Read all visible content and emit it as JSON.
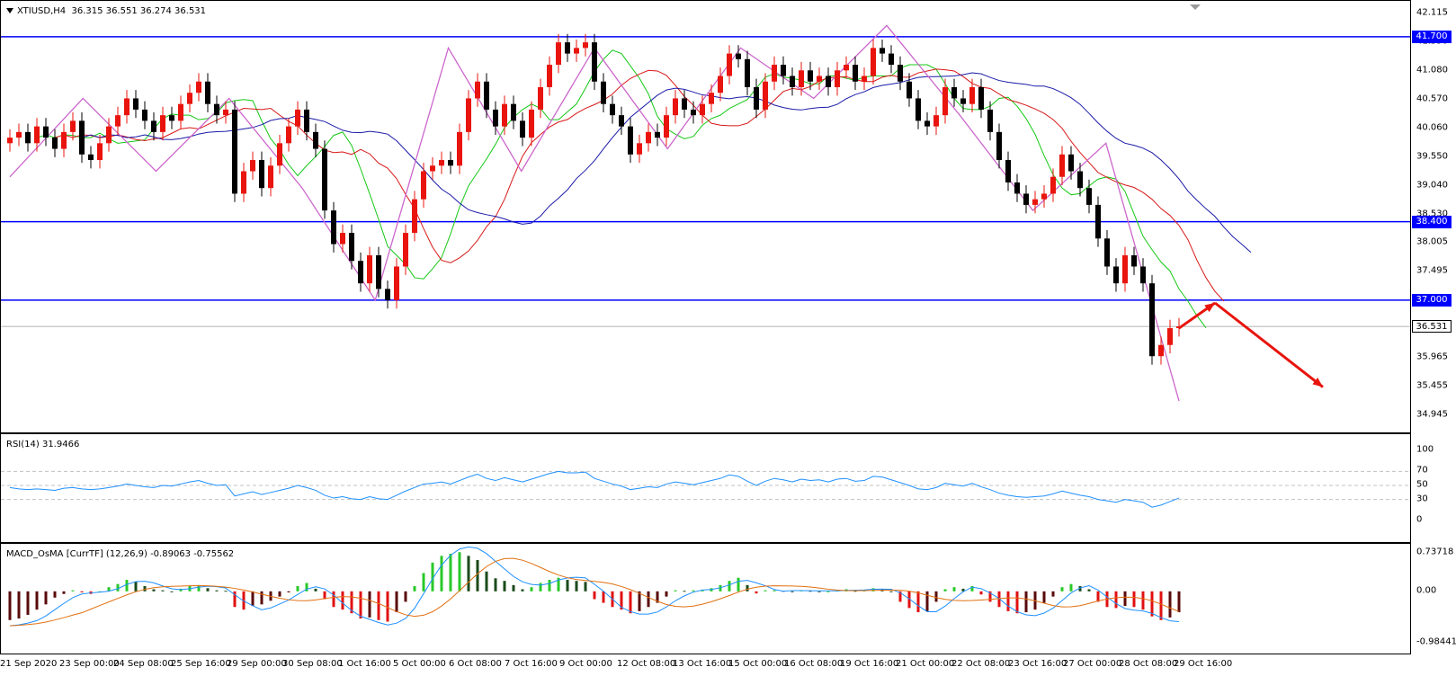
{
  "chart_header": {
    "symbol_timeframe": "XTIUSD,H4",
    "ohlc": "36.315 36.551 36.274 36.531"
  },
  "price_axis": [
    "42.115",
    "41.590",
    "41.080",
    "40.570",
    "40.060",
    "39.550",
    "39.040",
    "38.530",
    "38.005",
    "37.495",
    "36.985",
    "36.475",
    "35.965",
    "35.455",
    "34.945"
  ],
  "levels": [
    {
      "name": "resistance-41700",
      "label": "41.700",
      "value": 41.7,
      "color": "#0000ff"
    },
    {
      "name": "support-38400",
      "label": "38.400",
      "value": 38.4,
      "color": "#0000ff"
    },
    {
      "name": "support-37000",
      "label": "37.000",
      "value": 37.0,
      "color": "#0000ff"
    }
  ],
  "current_price": {
    "label": "36.531",
    "value": 36.531
  },
  "rsi": {
    "title": "RSI(14) 31.9466",
    "axis": [
      "100",
      "70",
      "50",
      "30",
      "0"
    ]
  },
  "macd": {
    "title": "MACD_OsMA [CurrTF] (12,26,9) -0.89063 -0.75562",
    "axis": [
      "0.73718",
      "0.00",
      "-0.98441"
    ]
  },
  "time_axis": [
    "21 Sep 2020",
    "23 Sep 00:00",
    "24 Sep 08:00",
    "25 Sep 16:00",
    "29 Sep 00:00",
    "30 Sep 08:00",
    "1 Oct 16:00",
    "5 Oct 00:00",
    "6 Oct 08:00",
    "7 Oct 16:00",
    "9 Oct 00:00",
    "12 Oct 08:00",
    "13 Oct 16:00",
    "15 Oct 00:00",
    "16 Oct 08:00",
    "19 Oct 16:00",
    "21 Oct 00:00",
    "22 Oct 08:00",
    "23 Oct 16:00",
    "27 Oct 00:00",
    "28 Oct 08:00",
    "29 Oct 16:00"
  ],
  "chart_data": {
    "type": "candlestick",
    "symbol": "XTIUSD",
    "timeframe": "H4",
    "ylim": [
      34.945,
      42.115
    ],
    "closes": [
      39.9,
      40.0,
      39.8,
      40.1,
      39.9,
      39.7,
      40.0,
      40.2,
      39.6,
      39.5,
      39.8,
      40.1,
      40.3,
      40.6,
      40.4,
      40.2,
      40.0,
      40.3,
      40.2,
      40.5,
      40.7,
      40.9,
      40.5,
      40.3,
      40.4,
      38.9,
      39.3,
      39.5,
      39.0,
      39.4,
      39.8,
      40.1,
      40.4,
      40.0,
      39.7,
      38.6,
      38.0,
      38.2,
      37.7,
      37.3,
      37.8,
      37.2,
      37.0,
      37.6,
      38.2,
      38.8,
      39.3,
      39.4,
      39.5,
      39.4,
      40.0,
      40.6,
      40.9,
      40.4,
      40.1,
      40.5,
      40.2,
      39.9,
      40.4,
      40.8,
      41.2,
      41.6,
      41.4,
      41.5,
      41.6,
      40.9,
      40.5,
      40.3,
      40.1,
      39.6,
      39.8,
      40.0,
      39.9,
      40.3,
      40.6,
      40.4,
      40.3,
      40.5,
      40.7,
      41.0,
      41.4,
      41.3,
      40.8,
      40.4,
      40.9,
      41.2,
      41.0,
      40.8,
      41.1,
      40.9,
      41.0,
      40.8,
      41.1,
      41.2,
      40.9,
      41.0,
      41.5,
      41.4,
      41.2,
      40.9,
      40.6,
      40.2,
      40.1,
      40.3,
      40.8,
      40.6,
      40.5,
      40.8,
      40.4,
      40.0,
      39.5,
      39.1,
      38.9,
      38.7,
      38.8,
      38.9,
      39.2,
      39.6,
      39.3,
      39.0,
      38.7,
      38.1,
      37.6,
      37.3,
      37.8,
      37.6,
      37.3,
      36.0,
      36.2,
      36.5,
      36.531
    ],
    "zigzag": [
      39.2,
      40.6,
      39.3,
      40.6,
      39.0,
      37.0,
      41.5,
      39.3,
      41.5,
      39.7,
      41.5,
      40.6,
      41.9,
      40.3,
      38.6,
      39.8,
      35.2
    ],
    "levels": [
      41.7,
      38.4,
      37.0
    ],
    "rsi_series": [
      47,
      45,
      44,
      45,
      44,
      43,
      46,
      47,
      45,
      44,
      45,
      47,
      49,
      52,
      50,
      48,
      47,
      50,
      49,
      52,
      55,
      57,
      53,
      50,
      51,
      35,
      38,
      41,
      37,
      40,
      43,
      46,
      50,
      47,
      43,
      36,
      32,
      34,
      31,
      30,
      34,
      31,
      30,
      36,
      42,
      47,
      52,
      53,
      55,
      52,
      57,
      62,
      66,
      60,
      57,
      61,
      58,
      55,
      59,
      63,
      67,
      70,
      68,
      68,
      69,
      60,
      56,
      52,
      49,
      44,
      46,
      48,
      47,
      52,
      55,
      53,
      51,
      54,
      57,
      60,
      65,
      63,
      56,
      50,
      56,
      60,
      58,
      55,
      59,
      57,
      58,
      55,
      59,
      60,
      56,
      57,
      63,
      62,
      58,
      54,
      50,
      45,
      44,
      47,
      53,
      51,
      49,
      53,
      48,
      44,
      39,
      36,
      34,
      33,
      34,
      35,
      38,
      42,
      39,
      36,
      34,
      30,
      28,
      26,
      30,
      28,
      26,
      19,
      22,
      27,
      31.9466
    ],
    "macd_hist": [
      -0.55,
      -0.52,
      -0.45,
      -0.35,
      -0.25,
      -0.12,
      -0.05,
      0.02,
      -0.02,
      -0.05,
      0.0,
      0.08,
      0.14,
      0.22,
      0.18,
      0.1,
      0.04,
      0.02,
      0.0,
      0.05,
      0.1,
      0.12,
      0.06,
      0.02,
      0.01,
      -0.3,
      -0.35,
      -0.28,
      -0.25,
      -0.18,
      -0.1,
      -0.02,
      0.1,
      0.16,
      0.05,
      -0.15,
      -0.3,
      -0.35,
      -0.42,
      -0.52,
      -0.5,
      -0.55,
      -0.58,
      -0.4,
      -0.2,
      0.1,
      0.35,
      0.55,
      0.68,
      0.72,
      0.75,
      0.68,
      0.6,
      0.38,
      0.25,
      0.2,
      0.12,
      0.04,
      0.08,
      0.16,
      0.22,
      0.26,
      0.22,
      0.2,
      0.18,
      -0.15,
      -0.22,
      -0.3,
      -0.35,
      -0.42,
      -0.38,
      -0.3,
      -0.22,
      -0.1,
      0.02,
      0.01,
      0.02,
      0.03,
      0.06,
      0.12,
      0.2,
      0.26,
      0.12,
      -0.04,
      0.02,
      0.02,
      0.01,
      0.0,
      0.02,
      0.01,
      0.0,
      0.0,
      0.02,
      0.04,
      0.01,
      0.02,
      0.06,
      0.05,
      0.0,
      -0.2,
      -0.32,
      -0.4,
      -0.38,
      -0.2,
      0.04,
      0.08,
      0.05,
      0.1,
      -0.06,
      -0.2,
      -0.3,
      -0.38,
      -0.42,
      -0.4,
      -0.35,
      -0.22,
      -0.1,
      0.08,
      0.14,
      0.1,
      0.04,
      -0.2,
      -0.3,
      -0.32,
      -0.28,
      -0.3,
      -0.35,
      -0.48,
      -0.55,
      -0.5,
      -0.4
    ],
    "macd_ylim": [
      -0.98441,
      0.73718
    ],
    "forecast_arrows": [
      {
        "from_index": 130,
        "from_price": 36.5,
        "to_index": 134,
        "to_price": 36.95,
        "color": "#e8140d"
      },
      {
        "from_index": 134,
        "from_price": 36.95,
        "to_index": 146,
        "to_price": 35.45,
        "color": "#e8140d"
      }
    ]
  }
}
